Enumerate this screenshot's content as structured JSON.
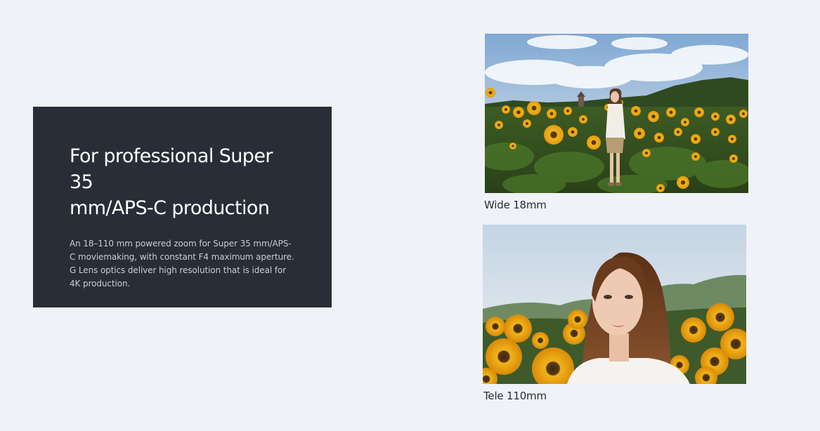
{
  "feature": {
    "title_line1": "For professional Super 35",
    "title_line2": "mm/APS-C production",
    "description": "An 18–110 mm powered zoom for Super 35 mm/APS-C moviemaking, with constant F4 maximum aperture. G Lens optics deliver high resolution that is ideal for 4K production."
  },
  "samples": [
    {
      "caption": "Wide 18mm",
      "image": "sunflower-field-wide-photo"
    },
    {
      "caption": "Tele 110mm",
      "image": "sunflower-portrait-tele-photo"
    }
  ],
  "colors": {
    "page_background": "#eff2f7",
    "panel_background": "#292d38",
    "title_text": "#ffffff",
    "body_text": "#c9ccd3",
    "caption_text": "#2b2d33"
  }
}
